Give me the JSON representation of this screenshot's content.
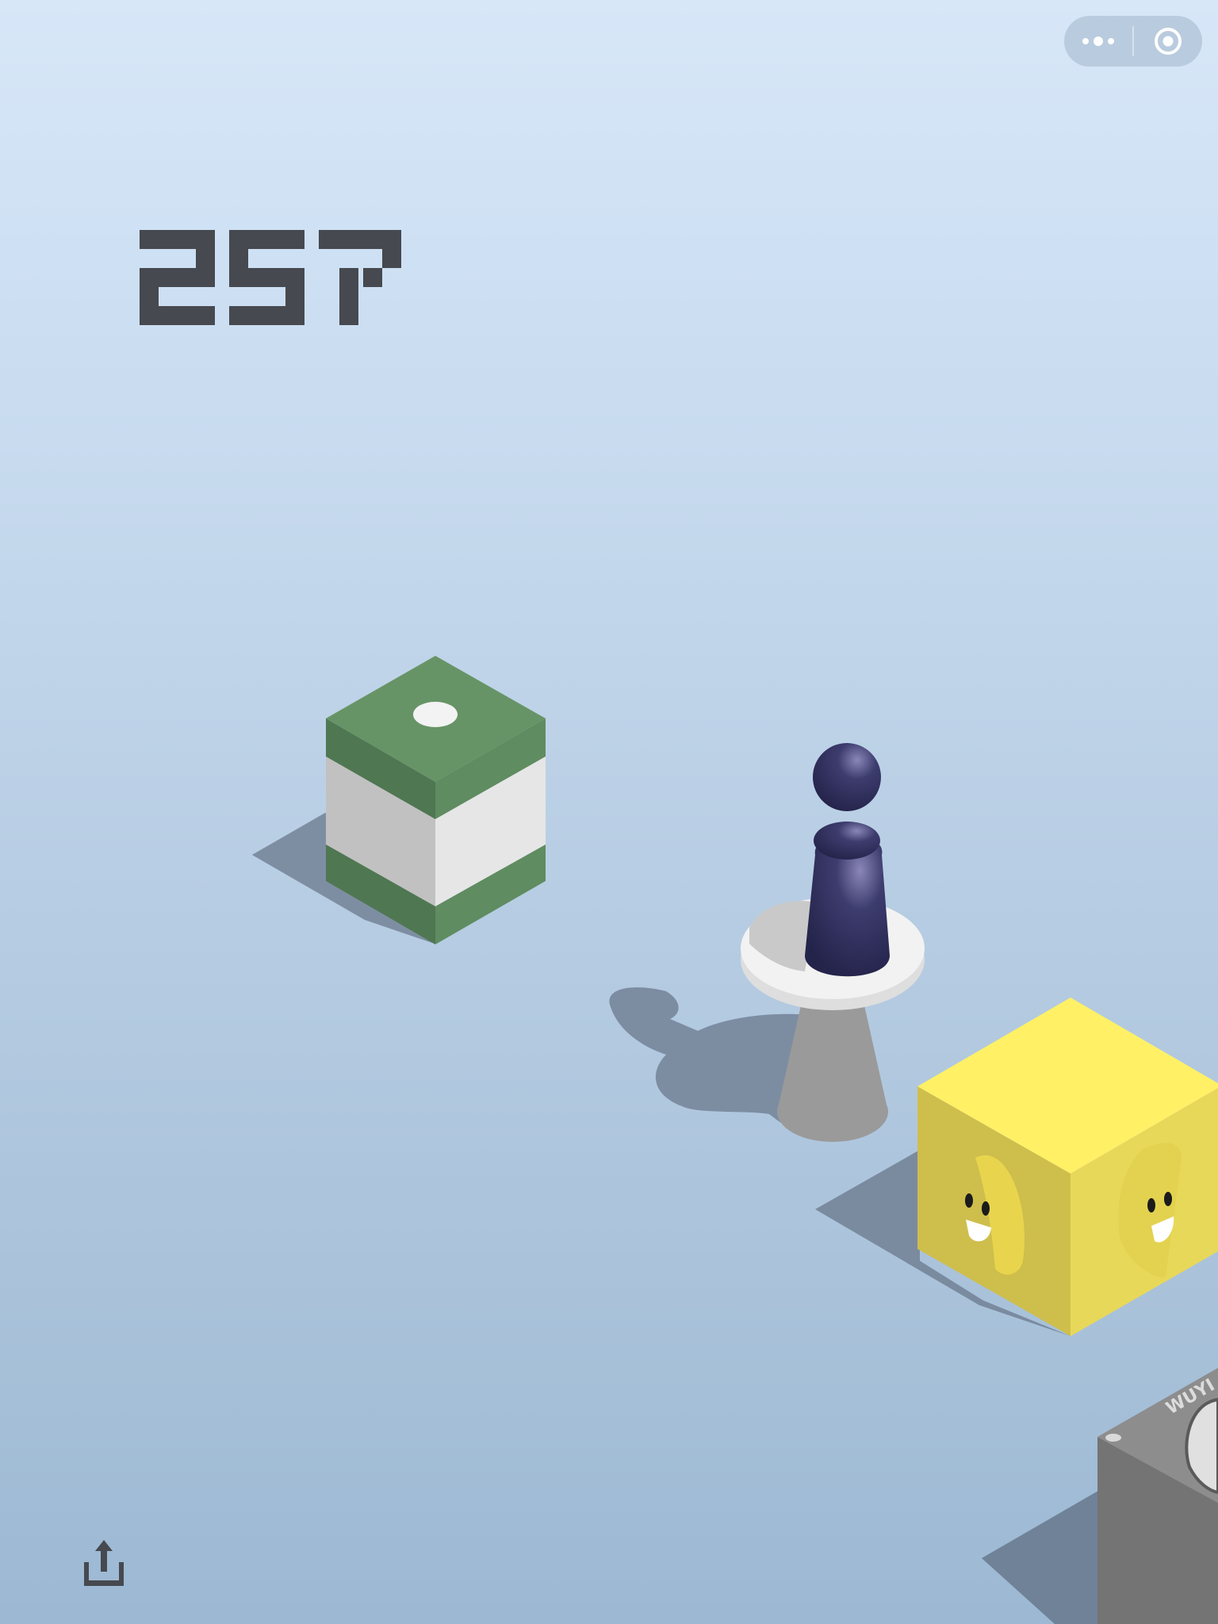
{
  "game": {
    "score": "257",
    "score_color": "#46494f"
  },
  "menu": {
    "more_icon": "more-dots-icon",
    "close_icon": "target-close-icon"
  },
  "footer": {
    "share_icon": "share-upload-icon"
  },
  "scene": {
    "background_top": "#d7e7f8",
    "background_bottom": "#9cb8d3",
    "green_block_top": "#679466",
    "green_block_side_dark": "#4e7651",
    "yellow_block_top": "#fff066",
    "yellow_block_side": "#cebe4c",
    "player_color": "#2c2b52",
    "pedestal_color": "#e9e9e9",
    "gray_block_color": "#767676",
    "gray_block_text": "WUYI"
  }
}
